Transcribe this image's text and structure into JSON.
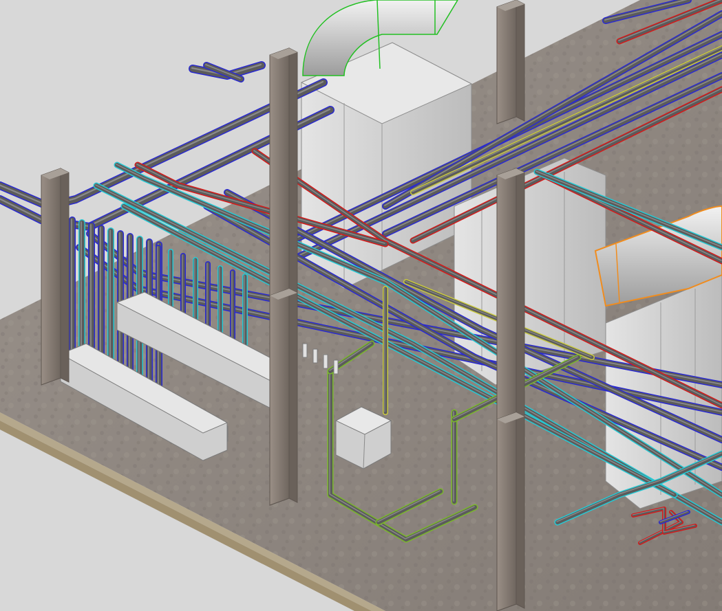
{
  "scene": {
    "kind": "isometric-3d-mep-model",
    "colors": {
      "background": "#d8d8d8",
      "slab_top": "#8f8782",
      "slab_edge": "#b5a88c",
      "column": "#8a7f76",
      "equipment": "#d2d2d2",
      "pipe_body": "#5b5b5b",
      "pipe_blue": "#2a2ad0",
      "pipe_red": "#d41a1a",
      "pipe_cyan": "#26c9d4",
      "pipe_yellow": "#c8c840",
      "pipe_green": "#7ab82a",
      "duct_edge_green": "#22c022",
      "duct_edge_orange": "#f08c1e"
    },
    "objects": {
      "columns": 5,
      "headers": 2,
      "air_handlers": 2,
      "junction_box": 1
    }
  }
}
